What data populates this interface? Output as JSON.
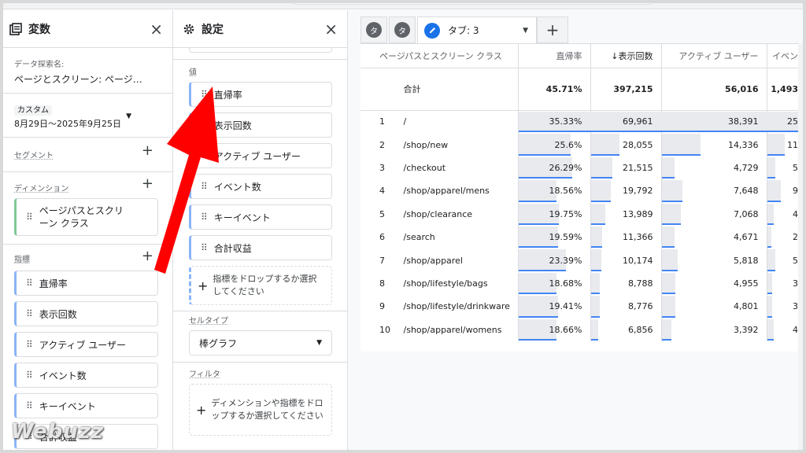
{
  "variables_panel": {
    "title": "変数",
    "close_icon": "×",
    "explore_name_label": "データ探索名:",
    "explore_name_value": "ページとスクリーン: ページ…",
    "date_badge": "カスタム",
    "date_range": "8月29日〜2025年9月25日",
    "segment_label": "セグメント",
    "dimension_label": "ディメンション",
    "dimension_item": "ページパスとスクリーン クラス",
    "metric_label": "指標",
    "metrics": [
      "直帰率",
      "表示回数",
      "アクティブ ユーザー",
      "イベント数",
      "キーイベント",
      "合計収益"
    ]
  },
  "settings_panel": {
    "title": "設定",
    "close_icon": "×",
    "values_label": "値",
    "values": [
      "直帰率",
      "表示回数",
      "アクティブ ユーザー",
      "イベント数",
      "キーイベント",
      "合計収益"
    ],
    "drop_metric": "指標をドロップするか選択してください",
    "cell_type_label": "セルタイプ",
    "cell_type_value": "棒グラフ",
    "filter_label": "フィルタ",
    "drop_filter": "ディメンションや指標をドロップするか選択してください"
  },
  "tabs": {
    "small_tab_1": "タ",
    "small_tab_2": "タ",
    "active_tab": "タブ: 3",
    "add": "+"
  },
  "table": {
    "headers": [
      "ページパスとスクリーン クラス",
      "直帰率",
      "↓表示回数",
      "アクティブ ユーザー",
      "イベン"
    ],
    "total_label": "合計",
    "totals": [
      "45.71%",
      "397,215",
      "56,016",
      "1,493"
    ],
    "rows": [
      {
        "idx": "1",
        "path": "/",
        "bounce": "35.33%",
        "views": "69,961",
        "users": "38,391",
        "events": "25"
      },
      {
        "idx": "2",
        "path": "/shop/new",
        "bounce": "25.6%",
        "views": "28,055",
        "users": "14,336",
        "events": "11"
      },
      {
        "idx": "3",
        "path": "/checkout",
        "bounce": "26.29%",
        "views": "21,515",
        "users": "4,729",
        "events": "5"
      },
      {
        "idx": "4",
        "path": "/shop/apparel/mens",
        "bounce": "18.56%",
        "views": "19,792",
        "users": "7,648",
        "events": "9"
      },
      {
        "idx": "5",
        "path": "/shop/clearance",
        "bounce": "19.75%",
        "views": "13,989",
        "users": "7,068",
        "events": "4"
      },
      {
        "idx": "6",
        "path": "/search",
        "bounce": "19.59%",
        "views": "11,366",
        "users": "4,671",
        "events": "2"
      },
      {
        "idx": "7",
        "path": "/shop/apparel",
        "bounce": "23.39%",
        "views": "10,174",
        "users": "5,818",
        "events": "5"
      },
      {
        "idx": "8",
        "path": "/shop/lifestyle/bags",
        "bounce": "18.68%",
        "views": "8,788",
        "users": "4,955",
        "events": "3"
      },
      {
        "idx": "9",
        "path": "/shop/lifestyle/drinkware",
        "bounce": "19.41%",
        "views": "8,776",
        "users": "4,801",
        "events": "3"
      },
      {
        "idx": "10",
        "path": "/shop/apparel/womens",
        "bounce": "18.66%",
        "views": "6,856",
        "users": "3,392",
        "events": "4"
      }
    ]
  },
  "bars": {
    "bounce": [
      1.0,
      0.72,
      0.74,
      0.53,
      0.56,
      0.55,
      0.66,
      0.53,
      0.55,
      0.53
    ],
    "views": [
      1.0,
      0.4,
      0.31,
      0.28,
      0.2,
      0.16,
      0.15,
      0.13,
      0.13,
      0.1
    ],
    "users": [
      1.0,
      0.37,
      0.12,
      0.2,
      0.18,
      0.12,
      0.15,
      0.13,
      0.13,
      0.09
    ],
    "events": [
      1.0,
      0.45,
      0.2,
      0.35,
      0.16,
      0.1,
      0.2,
      0.12,
      0.12,
      0.16
    ]
  },
  "colors": {
    "accent": "#1a73e8",
    "arrow": "#ff0000",
    "bar_fill": "#e8eaed",
    "bar_underline": "#4285f4"
  },
  "watermark": "Webuzz"
}
